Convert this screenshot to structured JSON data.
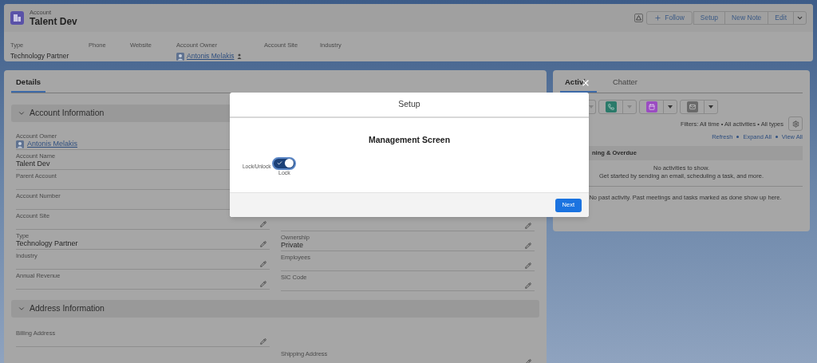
{
  "record_header": {
    "object_type": "Account",
    "title": "Talent Dev",
    "actions": [
      {
        "kind": "icon"
      },
      {
        "kind": "follow",
        "label": "Follow"
      },
      {
        "kind": "group",
        "label": "Setup"
      },
      {
        "kind": "group",
        "label": "New Note"
      },
      {
        "kind": "group",
        "label": "Edit"
      },
      {
        "kind": "menu"
      }
    ],
    "fields": [
      {
        "label": "Type",
        "value": "Technology Partner"
      },
      {
        "label": "Phone"
      },
      {
        "label": "Website"
      },
      {
        "label": "Account Owner",
        "value": "Antonis Melakis",
        "kind": "user"
      },
      {
        "label": "Account Site"
      },
      {
        "label": "Industry"
      }
    ]
  },
  "details": {
    "tabs": [
      {
        "label": "Details",
        "selected": true
      }
    ],
    "sections": [
      {
        "title": "Account Information",
        "expanded": true,
        "left_fields": [
          {
            "label": "Account Owner",
            "value": "Antonis Melakis",
            "kind": "user",
            "editable": false
          },
          {
            "label": "Account Name",
            "value": "Talent Dev",
            "editable": false
          },
          {
            "label": "Parent Account",
            "editable": false
          },
          {
            "label": "Account Number",
            "editable": false
          },
          {
            "label": "Account Site",
            "editable": true
          },
          {
            "label": "Type",
            "value": "Technology Partner",
            "editable": true
          },
          {
            "label": "Industry",
            "editable": true
          },
          {
            "label": "Annual Revenue",
            "editable": true
          }
        ],
        "right_fields": [
          {
            "editable": true
          },
          {
            "label": "Ownership",
            "value": "Private",
            "editable": true
          },
          {
            "label": "Employees",
            "editable": true
          },
          {
            "label": "SIC Code",
            "editable": true
          }
        ]
      },
      {
        "title": "Address Information",
        "expanded": true,
        "left_fields": [
          {
            "label": "Billing Address",
            "editable": true
          }
        ],
        "right_fields": [
          {
            "label": "Shipping Address",
            "editable": true
          }
        ]
      }
    ]
  },
  "activity": {
    "tabs": [
      {
        "label": "Activi",
        "selected": true
      },
      {
        "label": "Chatter",
        "selected": false
      }
    ],
    "quick_actions": [
      {
        "kind": "caret_only"
      },
      {
        "kind": "call",
        "disabled": true
      },
      {
        "kind": "event",
        "disabled": false
      },
      {
        "kind": "email",
        "disabled": false
      }
    ],
    "filters": "Filters: All time • All activities • All types",
    "links": [
      "Refresh",
      "Expand All",
      "View All"
    ],
    "upcoming": {
      "title": "ning & Overdue",
      "expanded": true,
      "message_lines": [
        "No activities to show.",
        "Get started by sending an email, scheduling a task, and more."
      ]
    },
    "past_message": "No past activity. Past meetings and tasks marked as done show up here."
  },
  "modal": {
    "title": "Setup",
    "heading": "Management Screen",
    "toggle": {
      "label": "Lock/Unlock",
      "on": true,
      "state_text": "Lock"
    },
    "primary_button": "Next"
  }
}
